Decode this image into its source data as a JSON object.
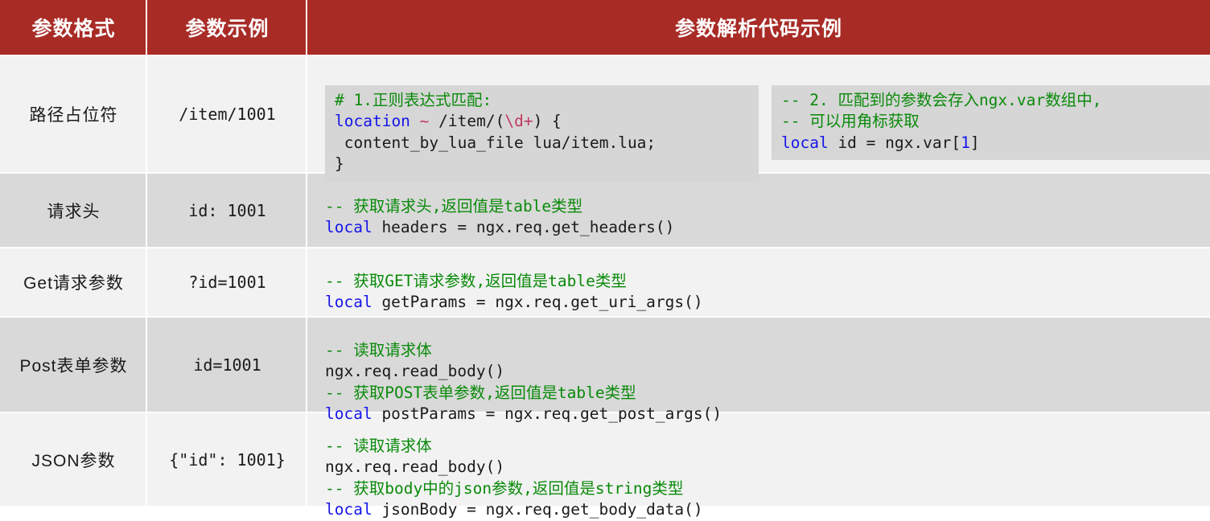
{
  "header": {
    "columns": [
      {
        "label": "参数格式"
      },
      {
        "label": "参数示例"
      },
      {
        "label": "参数解析代码示例"
      }
    ]
  },
  "rows": [
    {
      "format": "路径占位符",
      "example": "/item/1001",
      "code_blocks": [
        {
          "lines": [
            "# 1.正则表达式匹配:",
            "location ~ /item/(\\d+) {",
            " content_by_lua_file lua/item.lua;",
            "}"
          ]
        },
        {
          "lines": [
            "-- 2. 匹配到的参数会存入ngx.var数组中,",
            "-- 可以用角标获取",
            "local id = ngx.var[1]"
          ]
        }
      ]
    },
    {
      "format": "请求头",
      "example": "id: 1001",
      "code_blocks": [
        {
          "lines": [
            "-- 获取请求头,返回值是table类型",
            "local headers = ngx.req.get_headers()"
          ]
        }
      ]
    },
    {
      "format": "Get请求参数",
      "example": "?id=1001",
      "code_blocks": [
        {
          "lines": [
            "-- 获取GET请求参数,返回值是table类型",
            "local getParams = ngx.req.get_uri_args()"
          ]
        }
      ]
    },
    {
      "format": "Post表单参数",
      "example": "id=1001",
      "code_blocks": [
        {
          "lines": [
            "-- 读取请求体",
            "ngx.req.read_body()",
            "-- 获取POST表单参数,返回值是table类型",
            "local postParams = ngx.req.get_post_args()"
          ]
        }
      ]
    },
    {
      "format": "JSON参数",
      "example": "{\"id\": 1001}",
      "code_blocks": [
        {
          "lines": [
            "-- 读取请求体",
            "ngx.req.read_body()",
            "-- 获取body中的json参数,返回值是string类型",
            "local jsonBody = ngx.req.get_body_data()"
          ]
        }
      ]
    }
  ],
  "colors": {
    "header_bg": "#A82B26",
    "row_odd_bg": "#F2F2F2",
    "row_even_bg": "#D9D9D9",
    "code_bg": "#D6D6D6",
    "comment": "#0A8A0A",
    "keyword": "#1515E8",
    "regex": "#C13A5E",
    "text": "#1A1A1A"
  }
}
